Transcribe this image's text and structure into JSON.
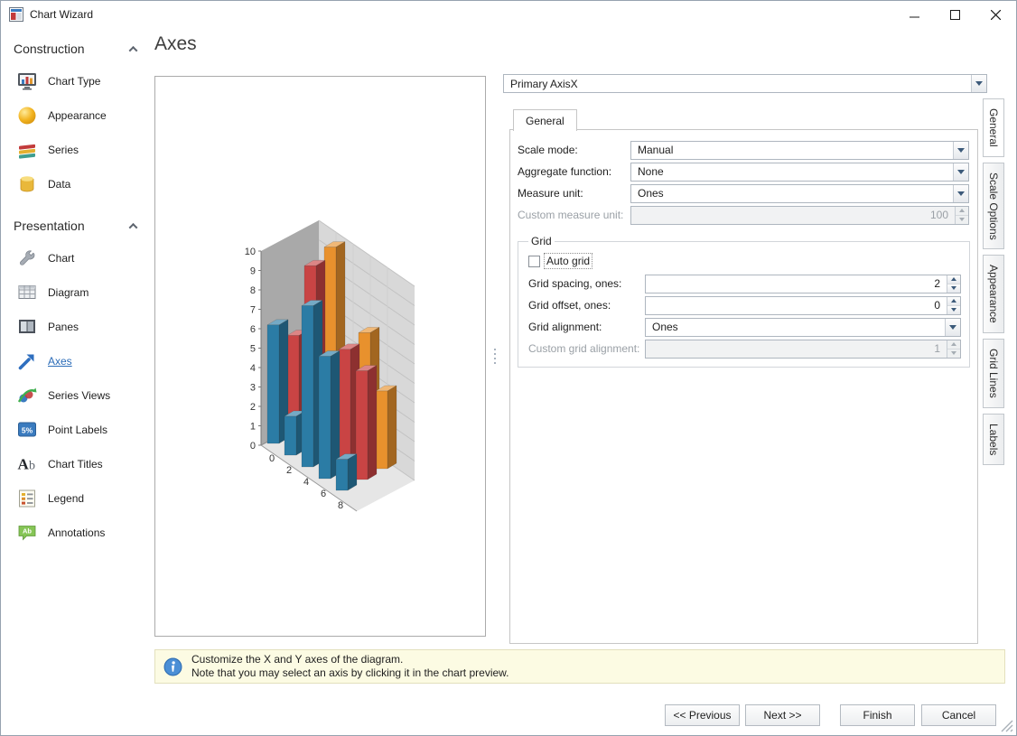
{
  "window": {
    "title": "Chart Wizard"
  },
  "sidebar": {
    "groups": [
      {
        "label": "Construction",
        "items": [
          {
            "label": "Chart Type",
            "icon": "chart-type-icon"
          },
          {
            "label": "Appearance",
            "icon": "appearance-icon"
          },
          {
            "label": "Series",
            "icon": "series-icon"
          },
          {
            "label": "Data",
            "icon": "data-icon"
          }
        ]
      },
      {
        "label": "Presentation",
        "items": [
          {
            "label": "Chart",
            "icon": "chart-icon"
          },
          {
            "label": "Diagram",
            "icon": "diagram-icon"
          },
          {
            "label": "Panes",
            "icon": "panes-icon"
          },
          {
            "label": "Axes",
            "icon": "axes-icon",
            "selected": true
          },
          {
            "label": "Series Views",
            "icon": "series-views-icon"
          },
          {
            "label": "Point Labels",
            "icon": "point-labels-icon"
          },
          {
            "label": "Chart Titles",
            "icon": "chart-titles-icon"
          },
          {
            "label": "Legend",
            "icon": "legend-icon"
          },
          {
            "label": "Annotations",
            "icon": "annotations-icon"
          }
        ]
      }
    ]
  },
  "page": {
    "title": "Axes"
  },
  "axis_selector": {
    "value": "Primary AxisX"
  },
  "tab": {
    "label": "General"
  },
  "side_tabs": [
    {
      "label": "General",
      "active": true
    },
    {
      "label": "Scale Options",
      "active": false
    },
    {
      "label": "Appearance",
      "active": false
    },
    {
      "label": "Grid Lines",
      "active": false
    },
    {
      "label": "Labels",
      "active": false
    }
  ],
  "form": {
    "scale_mode_label": "Scale mode:",
    "scale_mode_value": "Manual",
    "aggregate_label": "Aggregate function:",
    "aggregate_value": "None",
    "measure_unit_label": "Measure unit:",
    "measure_unit_value": "Ones",
    "custom_measure_label": "Custom measure unit:",
    "custom_measure_value": "100",
    "grid": {
      "group_label": "Grid",
      "auto_grid_label": "Auto grid",
      "auto_grid_checked": false,
      "spacing_label": "Grid spacing, ones:",
      "spacing_value": "2",
      "offset_label": "Grid offset, ones:",
      "offset_value": "0",
      "alignment_label": "Grid alignment:",
      "alignment_value": "Ones",
      "custom_alignment_label": "Custom grid alignment:",
      "custom_alignment_value": "1"
    }
  },
  "info_bar": {
    "line1": "Customize the X and Y axes of the diagram.",
    "line2": "Note that you may select an axis by clicking it in the chart preview."
  },
  "footer": {
    "previous": "<< Previous",
    "next": "Next >>",
    "finish": "Finish",
    "cancel": "Cancel"
  },
  "chart_data": {
    "type": "bar",
    "is_3d": true,
    "title": "",
    "x": [
      0,
      2,
      4,
      6,
      8
    ],
    "series": [
      {
        "position": "back",
        "color": "#E8912D",
        "values": [
          4.2,
          9.6,
          3.5,
          6.4,
          4.0
        ]
      },
      {
        "position": "middle",
        "color": "#C94444",
        "values": [
          5.0,
          9.2,
          4.4,
          6.1,
          5.6
        ]
      },
      {
        "position": "front",
        "color": "#2B7CA5",
        "values": [
          6.1,
          2.0,
          8.3,
          6.3,
          1.6
        ]
      }
    ],
    "ylim": [
      0,
      10
    ],
    "y_ticks": [
      0,
      1,
      2,
      3,
      4,
      5,
      6,
      7,
      8,
      9,
      10
    ],
    "grid": true,
    "legend_position": "none"
  }
}
